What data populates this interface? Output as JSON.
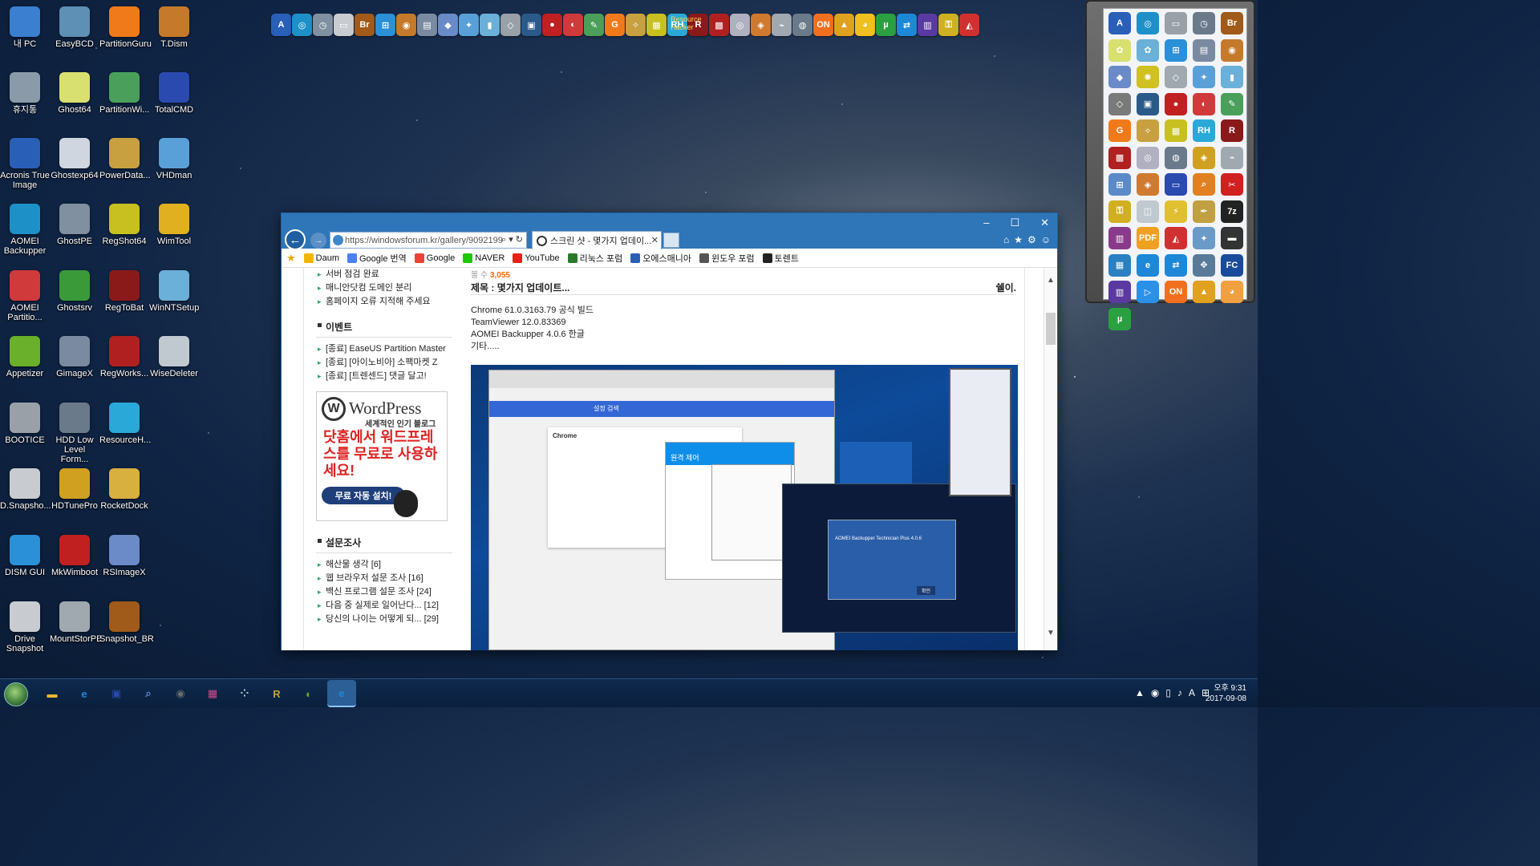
{
  "desktop_icons": [
    {
      "label": "내 PC",
      "icon": "computer-icon",
      "color": "#3a7fd0"
    },
    {
      "label": "EasyBCD",
      "icon": "easybcd-icon",
      "color": "#5e8fb5"
    },
    {
      "label": "PartitionGuru",
      "icon": "partitionguru-icon",
      "color": "#f07a1a"
    },
    {
      "label": "T.Dism",
      "icon": "tdism-icon",
      "color": "#c47a2a"
    },
    {
      "label": "휴지통",
      "icon": "recycle-bin-icon",
      "color": "#8a9aa8"
    },
    {
      "label": "Ghost64",
      "icon": "ghost-icon",
      "color": "#d8e070"
    },
    {
      "label": "PartitionWi...",
      "icon": "partition-wizard-icon",
      "color": "#4aa05a"
    },
    {
      "label": "TotalCMD",
      "icon": "floppy-icon",
      "color": "#2a4ab0"
    },
    {
      "label": "Acronis True Image",
      "icon": "acronis-icon",
      "color": "#2a5fb8"
    },
    {
      "label": "Ghostexp64",
      "icon": "ghostexp-icon",
      "color": "#cfd6e0"
    },
    {
      "label": "PowerData...",
      "icon": "powerdata-icon",
      "color": "#c8a040"
    },
    {
      "label": "VHDman",
      "icon": "vhdman-icon",
      "color": "#5aa0d8"
    },
    {
      "label": "AOMEI Backupper",
      "icon": "aomei-backupper-icon",
      "color": "#1e90c8"
    },
    {
      "label": "GhostPE",
      "icon": "ghostpe-icon",
      "color": "#8090a0"
    },
    {
      "label": "RegShot64",
      "icon": "regshot-icon",
      "color": "#c8c020"
    },
    {
      "label": "WimTool",
      "icon": "wimtool-icon",
      "color": "#e0b020"
    },
    {
      "label": "AOMEI Partitio...",
      "icon": "aomei-partition-icon",
      "color": "#d03a3a"
    },
    {
      "label": "Ghostsrv",
      "icon": "ghostsrv-icon",
      "color": "#3a9a3a"
    },
    {
      "label": "RegToBat",
      "icon": "regtobat-icon",
      "color": "#8a1a1a"
    },
    {
      "label": "WinNTSetup",
      "icon": "winntsetup-icon",
      "color": "#6ab0d8"
    },
    {
      "label": "Appetizer",
      "icon": "appetizer-icon",
      "color": "#6ab02a"
    },
    {
      "label": "GimageX",
      "icon": "gimagex-icon",
      "color": "#7a8aa0"
    },
    {
      "label": "RegWorks...",
      "icon": "regworks-icon",
      "color": "#b02020"
    },
    {
      "label": "WiseDeleter",
      "icon": "wisedeleter-icon",
      "color": "#c0c8d0"
    },
    {
      "label": "BOOTICE",
      "icon": "bootice-icon",
      "color": "#9aa0a8"
    },
    {
      "label": "HDD Low Level Form...",
      "icon": "hdd-low-level-icon",
      "color": "#6a7a8a"
    },
    {
      "label": "ResourceH...",
      "icon": "resourcehacker-icon",
      "color": "#2aa8d8"
    },
    {
      "label": "",
      "icon": "",
      "color": ""
    },
    {
      "label": "D.Snapsho...",
      "icon": "dsnapshot-icon",
      "color": "#c8ccd0"
    },
    {
      "label": "HDTunePro",
      "icon": "hdtune-icon",
      "color": "#d0a020"
    },
    {
      "label": "RocketDock",
      "icon": "rocketdock-icon",
      "color": "#d8b040"
    },
    {
      "label": "",
      "icon": "",
      "color": ""
    },
    {
      "label": "DISM GUI",
      "icon": "windows-logo-icon",
      "color": "#2a90d8"
    },
    {
      "label": "MkWimboot",
      "icon": "ladybug-icon",
      "color": "#c02020"
    },
    {
      "label": "RSImageX",
      "icon": "rsimagex-icon",
      "color": "#6a8ac8"
    },
    {
      "label": "",
      "icon": "",
      "color": ""
    },
    {
      "label": "Drive Snapshot",
      "icon": "drive-snapshot-icon",
      "color": "#c8ccd0"
    },
    {
      "label": "MountStorPE",
      "icon": "mountstorpe-icon",
      "color": "#a0a8b0"
    },
    {
      "label": "Snapshot_BR",
      "icon": "snapshot-br-icon",
      "color": "#a05a1a"
    }
  ],
  "topbar_icons": [
    {
      "glyph": "A",
      "color": "#2a5fb8"
    },
    {
      "glyph": "◎",
      "color": "#1e90c8"
    },
    {
      "glyph": "◷",
      "color": "#8090a0"
    },
    {
      "glyph": "▭",
      "color": "#c8ccd0"
    },
    {
      "glyph": "Br",
      "color": "#a05a1a"
    },
    {
      "glyph": "⊞",
      "color": "#2a90d8"
    },
    {
      "glyph": "◉",
      "color": "#c47a2a"
    },
    {
      "glyph": "▤",
      "color": "#7a8aa0"
    },
    {
      "glyph": "◆",
      "color": "#6a8ac8"
    },
    {
      "glyph": "✦",
      "color": "#5aa0d8"
    },
    {
      "glyph": "▮",
      "color": "#6ab0d8"
    },
    {
      "glyph": "◇",
      "color": "#9aa0a8"
    },
    {
      "glyph": "▣",
      "color": "#2a5a8a"
    },
    {
      "glyph": "●",
      "color": "#c02020"
    },
    {
      "glyph": "◐",
      "color": "#d03a3a"
    },
    {
      "glyph": "✎",
      "color": "#4aa05a"
    },
    {
      "glyph": "G",
      "color": "#f07a1a"
    },
    {
      "glyph": "✧",
      "color": "#c8a040"
    },
    {
      "glyph": "▦",
      "color": "#c8c020"
    },
    {
      "glyph": "RH",
      "color": "#2aa8d8"
    },
    {
      "glyph": "R",
      "color": "#8a1a1a"
    },
    {
      "glyph": "▩",
      "color": "#b02020"
    },
    {
      "glyph": "◎",
      "color": "#b0b0c0"
    },
    {
      "glyph": "◈",
      "color": "#d07a30"
    },
    {
      "glyph": "⌁",
      "color": "#a0a8b0"
    },
    {
      "glyph": "◍",
      "color": "#6a7a8a"
    },
    {
      "glyph": "ON",
      "color": "#f07020"
    },
    {
      "glyph": "▲",
      "color": "#e0a020"
    },
    {
      "glyph": "◕",
      "color": "#f0c020"
    },
    {
      "glyph": "µ",
      "color": "#2aa040"
    },
    {
      "glyph": "⇄",
      "color": "#1e88d8"
    },
    {
      "glyph": "▥",
      "color": "#5a3aa0"
    },
    {
      "glyph": "⚿",
      "color": "#d0b020"
    },
    {
      "glyph": "◭",
      "color": "#d03030"
    }
  ],
  "topbar_text": {
    "resource_hacker": "Resource Hacker"
  },
  "dock_icons": [
    {
      "glyph": "A",
      "color": "#2a5fb8"
    },
    {
      "glyph": "◎",
      "color": "#1e90c8"
    },
    {
      "glyph": "▭",
      "color": "#9aa0a8"
    },
    {
      "glyph": "◷",
      "color": "#6a7a8a"
    },
    {
      "glyph": "Br",
      "color": "#a05a1a"
    },
    {
      "glyph": "✿",
      "color": "#d8e070"
    },
    {
      "glyph": "✿",
      "color": "#6ab0d8"
    },
    {
      "glyph": "⊞",
      "color": "#2a90d8"
    },
    {
      "glyph": "▤",
      "color": "#7a8aa0"
    },
    {
      "glyph": "◉",
      "color": "#c47a2a"
    },
    {
      "glyph": "◆",
      "color": "#6a8ac8"
    },
    {
      "glyph": "✺",
      "color": "#d0c020"
    },
    {
      "glyph": "◇",
      "color": "#a0a8b0"
    },
    {
      "glyph": "✦",
      "color": "#5aa0d8"
    },
    {
      "glyph": "▮",
      "color": "#6ab0d8"
    },
    {
      "glyph": "◇",
      "color": "#7a7a7a"
    },
    {
      "glyph": "▣",
      "color": "#2a5a8a"
    },
    {
      "glyph": "●",
      "color": "#c02020"
    },
    {
      "glyph": "◐",
      "color": "#d03a3a"
    },
    {
      "glyph": "✎",
      "color": "#4aa05a"
    },
    {
      "glyph": "G",
      "color": "#f07a1a"
    },
    {
      "glyph": "✧",
      "color": "#c8a040"
    },
    {
      "glyph": "▦",
      "color": "#c8c020"
    },
    {
      "glyph": "RH",
      "color": "#2aa8d8"
    },
    {
      "glyph": "R",
      "color": "#8a1a1a"
    },
    {
      "glyph": "▩",
      "color": "#b02020"
    },
    {
      "glyph": "◎",
      "color": "#b0b0c0"
    },
    {
      "glyph": "◍",
      "color": "#6a7a8a"
    },
    {
      "glyph": "◈",
      "color": "#d0a020"
    },
    {
      "glyph": "⌁",
      "color": "#a0a8b0"
    },
    {
      "glyph": "⊞",
      "color": "#5a8ac8"
    },
    {
      "glyph": "◈",
      "color": "#d07a30"
    },
    {
      "glyph": "▭",
      "color": "#2a4ab0"
    },
    {
      "glyph": "⌕",
      "color": "#e08020"
    },
    {
      "glyph": "✂",
      "color": "#d02020"
    },
    {
      "glyph": "⚿",
      "color": "#d0b020"
    },
    {
      "glyph": "◫",
      "color": "#c0c8d0"
    },
    {
      "glyph": "⚡",
      "color": "#e0c030"
    },
    {
      "glyph": "✒",
      "color": "#c0a040"
    },
    {
      "glyph": "7z",
      "color": "#222222"
    },
    {
      "glyph": "▥",
      "color": "#8a3a8a"
    },
    {
      "glyph": "PDF",
      "color": "#f0a020"
    },
    {
      "glyph": "◭",
      "color": "#d03030"
    },
    {
      "glyph": "✦",
      "color": "#6a9ac8"
    },
    {
      "glyph": "▬",
      "color": "#333333"
    },
    {
      "glyph": "▦",
      "color": "#2a80c0"
    },
    {
      "glyph": "e",
      "color": "#1e88d8"
    },
    {
      "glyph": "⇄",
      "color": "#1e88d8"
    },
    {
      "glyph": "✥",
      "color": "#5a7a9a"
    },
    {
      "glyph": "FC",
      "color": "#1a4a9a"
    },
    {
      "glyph": "▥",
      "color": "#5a3aa0"
    },
    {
      "glyph": "▷",
      "color": "#2a90e8"
    },
    {
      "glyph": "ON",
      "color": "#f07020"
    },
    {
      "glyph": "▲",
      "color": "#e0a020"
    },
    {
      "glyph": "◕",
      "color": "#f0a040"
    },
    {
      "glyph": "µ",
      "color": "#2aa040"
    }
  ],
  "browser": {
    "url": "https://windowsforum.kr/gallery/9092199",
    "tab_title": "스크린 샷 - 몇가지 업데이...",
    "window_controls": {
      "minimize": "–",
      "maximize": "☐",
      "close": "✕"
    },
    "favorites": [
      {
        "label": "Daum",
        "color": "#f2b600"
      },
      {
        "label": "Google 번역",
        "color": "#4a80f0"
      },
      {
        "label": "Google",
        "color": "#ea4335"
      },
      {
        "label": "NAVER",
        "color": "#1ec800"
      },
      {
        "label": "YouTube",
        "color": "#e62117"
      },
      {
        "label": "리눅스 포럼",
        "color": "#2a7a2a"
      },
      {
        "label": "오에스매니아",
        "color": "#2a5fb8"
      },
      {
        "label": "윈도우 포럼",
        "color": "#555555"
      },
      {
        "label": "토렌트",
        "color": "#222222"
      }
    ]
  },
  "sidebar": {
    "notice_items": [
      "서버 점검 완료",
      "매니안닷컴 도메인 분리",
      "홈페이지 오류 지적해 주세요"
    ],
    "event_heading": "이벤트",
    "event_items": [
      "[종료] EaseUS Partition Master",
      "[종료] [아이노비아] 소팩마켓 Z",
      "[종료] [트렌센드] 댓글 달고!"
    ],
    "ad": {
      "logo_letter": "W",
      "brand": "WordPress",
      "tagline": "세계적인 인기 블로그",
      "headline": "닷홈에서 워드프레스를 무료로 사용하세요!",
      "button": "무료 자동 설치!"
    },
    "poll_heading": "설문조사",
    "poll_items": [
      "해산물 생각 [6]",
      "웹 브라우저 설문 조사 [16]",
      "백신 프로그램 설문 조사 [24]",
      "다음 중 실제로 일어난다... [12]",
      "당신의 나이는 어떻게 되... [29]"
    ]
  },
  "article": {
    "views_label": "볼 수",
    "views_count": "3,055",
    "title": "제목 : 몇가지 업데이트...",
    "author": "쉘이.",
    "body_lines": [
      "Chrome 61.0.3163.79 공식 빌드",
      "TeamViewer 12.0.83369",
      "AOMEI Backupper 4.0.6 한글",
      "기타....."
    ]
  },
  "embedded_screenshot": {
    "chrome_card_title": "Chrome",
    "chrome_search": "설정 검색",
    "teamviewer_title": "원격 제어",
    "aomei_title": "AOMEI Backupper Technician Plus 4.0.6",
    "aomei_ok": "확인"
  },
  "scroll_top": "⌃",
  "taskbar": {
    "apps": [
      {
        "icon": "folder-icon",
        "glyph": "▬",
        "color": "#e8b830"
      },
      {
        "icon": "ie-icon",
        "glyph": "e",
        "color": "#1e88d8"
      },
      {
        "icon": "floppy-icon",
        "glyph": "▣",
        "color": "#2a4ab0"
      },
      {
        "icon": "search-tool-icon",
        "glyph": "⌕",
        "color": "#5a8ac8"
      },
      {
        "icon": "tdism-icon",
        "glyph": "◉",
        "color": "#6a6a6a"
      },
      {
        "icon": "palette-icon",
        "glyph": "▦",
        "color": "#d04a8a"
      },
      {
        "icon": "grid-icon",
        "glyph": "⁘",
        "color": "#c0c8d0"
      },
      {
        "icon": "rocketdock-icon",
        "glyph": "R",
        "color": "#c8a040"
      },
      {
        "icon": "appetizer-icon",
        "glyph": "◐",
        "color": "#6ab02a"
      },
      {
        "icon": "ie-active-icon",
        "glyph": "e",
        "color": "#1e88d8"
      }
    ],
    "tray": [
      "▲",
      "◉",
      "▯",
      "♪",
      "A",
      "⊞"
    ],
    "time": "오후 9:31",
    "date": "2017-09-08"
  }
}
